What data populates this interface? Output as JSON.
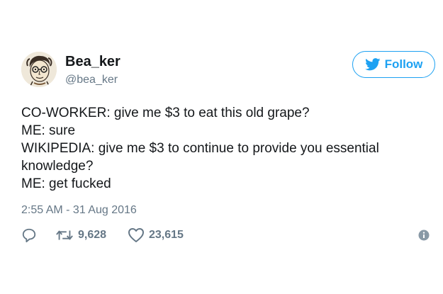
{
  "user": {
    "display_name": "Bea_ker",
    "handle": "@bea_ker",
    "avatar_icon": "illustrated-portrait-avatar"
  },
  "follow_button": {
    "label": "Follow",
    "icon": "twitter-bird-icon",
    "color": "#1da1f2"
  },
  "tweet": {
    "lines": [
      "CO-WORKER: give me $3 to eat this old grape?",
      "ME: sure",
      "WIKIPEDIA: give me $3 to continue to provide you essential",
      "knowledge?",
      "ME: get fucked"
    ],
    "timestamp": "2:55 AM - 31 Aug 2016"
  },
  "actions": {
    "reply_icon": "reply-icon",
    "retweet_icon": "retweet-icon",
    "retweet_count": "9,628",
    "like_icon": "heart-icon",
    "like_count": "23,615",
    "info_icon": "info-icon"
  },
  "colors": {
    "text": "#14171a",
    "secondary": "#657786",
    "accent": "#1da1f2"
  }
}
